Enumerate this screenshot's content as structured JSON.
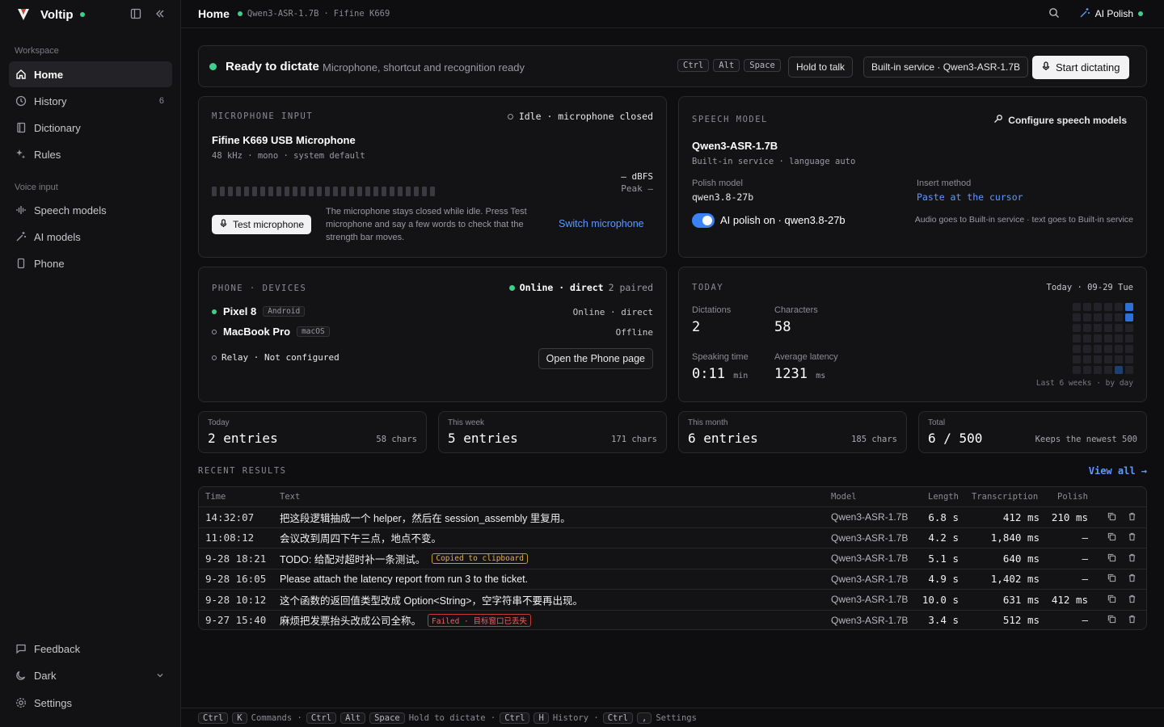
{
  "app": {
    "name": "Voltip"
  },
  "sidebar": {
    "workspace_label": "Workspace",
    "voice_label": "Voice input",
    "items": [
      {
        "label": "Home",
        "icon": "home-icon"
      },
      {
        "label": "History",
        "icon": "clock-icon",
        "count": "6"
      },
      {
        "label": "Dictionary",
        "icon": "book-icon"
      },
      {
        "label": "Rules",
        "icon": "sparkle-icon"
      }
    ],
    "voice_items": [
      {
        "label": "Speech models",
        "icon": "waveform-icon"
      },
      {
        "label": "AI models",
        "icon": "wand-icon"
      },
      {
        "label": "Phone",
        "icon": "phone-icon"
      }
    ],
    "bottom": {
      "feedback": "Feedback",
      "theme": "Dark",
      "settings": "Settings"
    }
  },
  "header": {
    "title": "Home",
    "model": "Qwen3-ASR-1.7B",
    "separator": "·",
    "mic": "Fifine K669",
    "ai_polish": "AI Polish"
  },
  "ready": {
    "title": "Ready to dictate",
    "subtitle": "Microphone, shortcut and recognition ready",
    "keys": [
      "Ctrl",
      "Alt",
      "Space"
    ],
    "mode": "Hold to talk",
    "service": "Built-in service · Qwen3-ASR-1.7B",
    "start": "Start dictating"
  },
  "mic": {
    "section": "MICROPHONE INPUT",
    "status": "Idle · microphone closed",
    "name": "Fifine K669 USB Microphone",
    "specs": "48 kHz · mono · system default",
    "dbfs": "— dBFS",
    "peak": "Peak —",
    "test": "Test microphone",
    "hint": "The microphone stays closed while idle. Press Test microphone and say a few words to check that the strength bar moves.",
    "switch": "Switch microphone",
    "level": 0
  },
  "speech": {
    "section": "SPEECH MODEL",
    "configure": "Configure speech models",
    "model": "Qwen3-ASR-1.7B",
    "detail": "Built-in service · language auto",
    "polish_label": "Polish model",
    "polish_value": "qwen3.8-27b",
    "insert_label": "Insert method",
    "insert_value": "Paste at the cursor",
    "toggle_label": "AI polish on · qwen3.8-27b",
    "routing": "Audio goes to Built-in service · text goes to Built-in service"
  },
  "phone": {
    "section": "PHONE · DEVICES",
    "status_word": "Online · direct",
    "paired": "2 paired",
    "devices": [
      {
        "name": "Pixel 8",
        "os": "Android",
        "status": "Online · direct",
        "online": true
      },
      {
        "name": "MacBook Pro",
        "os": "macOS",
        "status": "Offline",
        "online": false
      }
    ],
    "relay": "Relay · Not configured",
    "open": "Open the Phone page"
  },
  "today": {
    "section": "TODAY",
    "date": "Today · 09-29 Tue",
    "dictations_label": "Dictations",
    "dictations": "2",
    "characters_label": "Characters",
    "characters": "58",
    "speaking_label": "Speaking time",
    "speaking": "0:11",
    "speaking_unit": "min",
    "latency_label": "Average latency",
    "latency": "1231",
    "latency_unit": "ms",
    "heat_caption": "Last 6 weeks · by day"
  },
  "stats": [
    {
      "label": "Today",
      "value": "2 entries",
      "right": "58 chars"
    },
    {
      "label": "This week",
      "value": "5 entries",
      "right": "171 chars"
    },
    {
      "label": "This month",
      "value": "6 entries",
      "right": "185 chars"
    },
    {
      "label": "Total",
      "value": "6 / 500",
      "right": "Keeps the newest 500"
    }
  ],
  "recent": {
    "section": "RECENT RESULTS",
    "view_all": "View all →",
    "columns": [
      "Time",
      "Text",
      "Model",
      "Length",
      "Transcription",
      "Polish"
    ],
    "rows": [
      {
        "time": "14:32:07",
        "text": "把这段逻辑抽成一个 helper，然后在 session_assembly 里复用。",
        "badge": "",
        "model": "Qwen3-ASR-1.7B",
        "length": "6.8 s",
        "trans": "412 ms",
        "polish": "210 ms"
      },
      {
        "time": "11:08:12",
        "text": "会议改到周四下午三点，地点不变。",
        "badge": "",
        "model": "Qwen3-ASR-1.7B",
        "length": "4.2 s",
        "trans": "1,840 ms",
        "polish": "—"
      },
      {
        "time": "9-28 18:21",
        "text": "TODO: 给配对超时补一条测试。",
        "badge": "Copied to clipboard",
        "badge_type": "ok",
        "model": "Qwen3-ASR-1.7B",
        "length": "5.1 s",
        "trans": "640 ms",
        "polish": "—"
      },
      {
        "time": "9-28 16:05",
        "text": "Please attach the latency report from run 3 to the ticket.",
        "badge": "",
        "model": "Qwen3-ASR-1.7B",
        "length": "4.9 s",
        "trans": "1,402 ms",
        "polish": "—"
      },
      {
        "time": "9-28 10:12",
        "text": "这个函数的返回值类型改成 Option<String>，空字符串不要再出现。",
        "badge": "",
        "model": "Qwen3-ASR-1.7B",
        "length": "10.0 s",
        "trans": "631 ms",
        "polish": "412 ms"
      },
      {
        "time": "9-27 15:40",
        "text": "麻烦把发票抬头改成公司全称。",
        "badge": "Failed · 目标窗口已丢失",
        "badge_type": "fail",
        "model": "Qwen3-ASR-1.7B",
        "length": "3.4 s",
        "trans": "512 ms",
        "polish": "—"
      }
    ]
  },
  "footer": {
    "k1": "Ctrl",
    "k2": "K",
    "t1": "Commands ·",
    "k3": "Ctrl",
    "k4": "Alt",
    "k5": "Space",
    "t2": "Hold to dictate ·",
    "k6": "Ctrl",
    "k7": "H",
    "t3": "History ·",
    "k8": "Ctrl",
    "k9": ",",
    "t4": "Settings"
  },
  "colors": {
    "accent": "#3b82f6",
    "online": "#3ecf8e",
    "warn": "#e3b34a",
    "error": "#f06060"
  }
}
